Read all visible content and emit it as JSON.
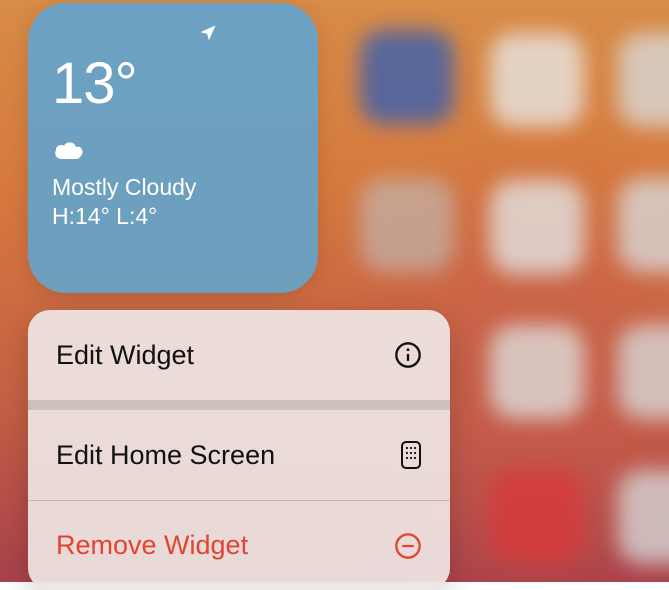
{
  "weather_widget": {
    "temperature": "13°",
    "condition": "Mostly Cloudy",
    "high_low": "H:14° L:4°"
  },
  "context_menu": {
    "items": [
      {
        "label": "Edit Widget",
        "icon": "info-icon",
        "destructive": false
      },
      {
        "label": "Edit Home Screen",
        "icon": "homescreen-icon",
        "destructive": false
      },
      {
        "label": "Remove Widget",
        "icon": "remove-icon",
        "destructive": true
      }
    ]
  },
  "colors": {
    "destructive": "#e24432"
  }
}
